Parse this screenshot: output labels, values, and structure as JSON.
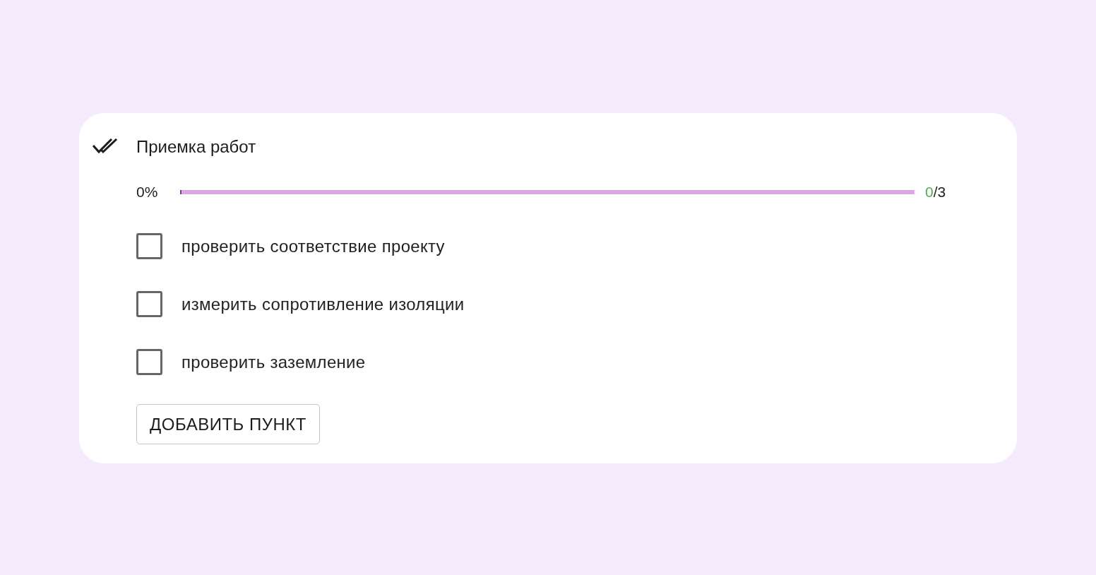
{
  "card": {
    "title": "Приемка работ",
    "progress": {
      "percent": "0%",
      "level": 0,
      "done": "0",
      "total": "/3"
    },
    "items": [
      {
        "label": "проверить соответствие проекту",
        "checked": false
      },
      {
        "label": "измерить сопротивление изоляции",
        "checked": false
      },
      {
        "label": "проверить заземление",
        "checked": false
      }
    ],
    "add_button": "ДОБАВИТЬ ПУНКТ"
  }
}
